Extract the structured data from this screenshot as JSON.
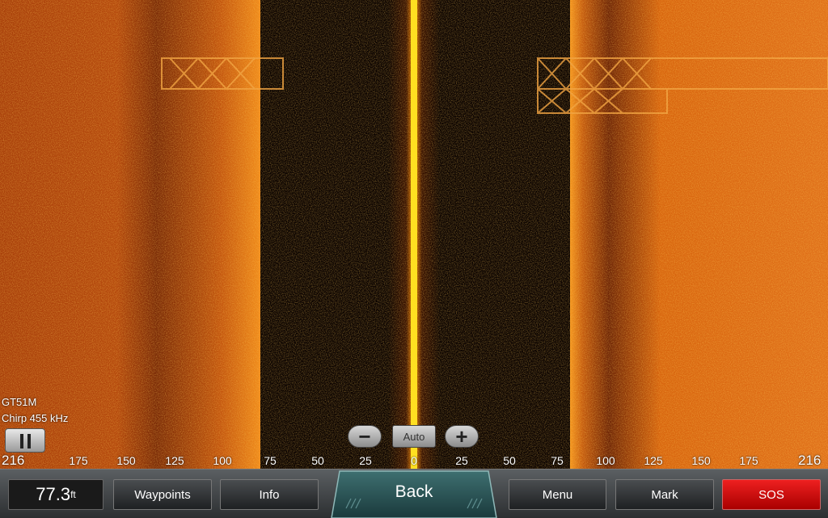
{
  "device": {
    "transducer": "GT51M",
    "frequency": "Chirp 455 kHz"
  },
  "controls": {
    "zoom_out_label": "−",
    "zoom_auto_label": "Auto",
    "zoom_in_label": "+"
  },
  "range_scale": {
    "left_end": "216",
    "right_end": "216",
    "ticks_left": [
      "175",
      "150",
      "125",
      "100",
      "75",
      "50",
      "25"
    ],
    "center": "0",
    "ticks_right": [
      "25",
      "50",
      "75",
      "100",
      "125",
      "150",
      "175"
    ]
  },
  "bottom_bar": {
    "depth_value": "77.3",
    "depth_unit": "ft",
    "waypoints_label": "Waypoints",
    "info_label": "Info",
    "back_label": "Back",
    "menu_label": "Menu",
    "mark_label": "Mark",
    "sos_label": "SOS"
  },
  "colors": {
    "sonar_primary": "#d9620c",
    "water_column": "#0a0200",
    "center_line": "#ffd200",
    "sos": "#d40000"
  }
}
